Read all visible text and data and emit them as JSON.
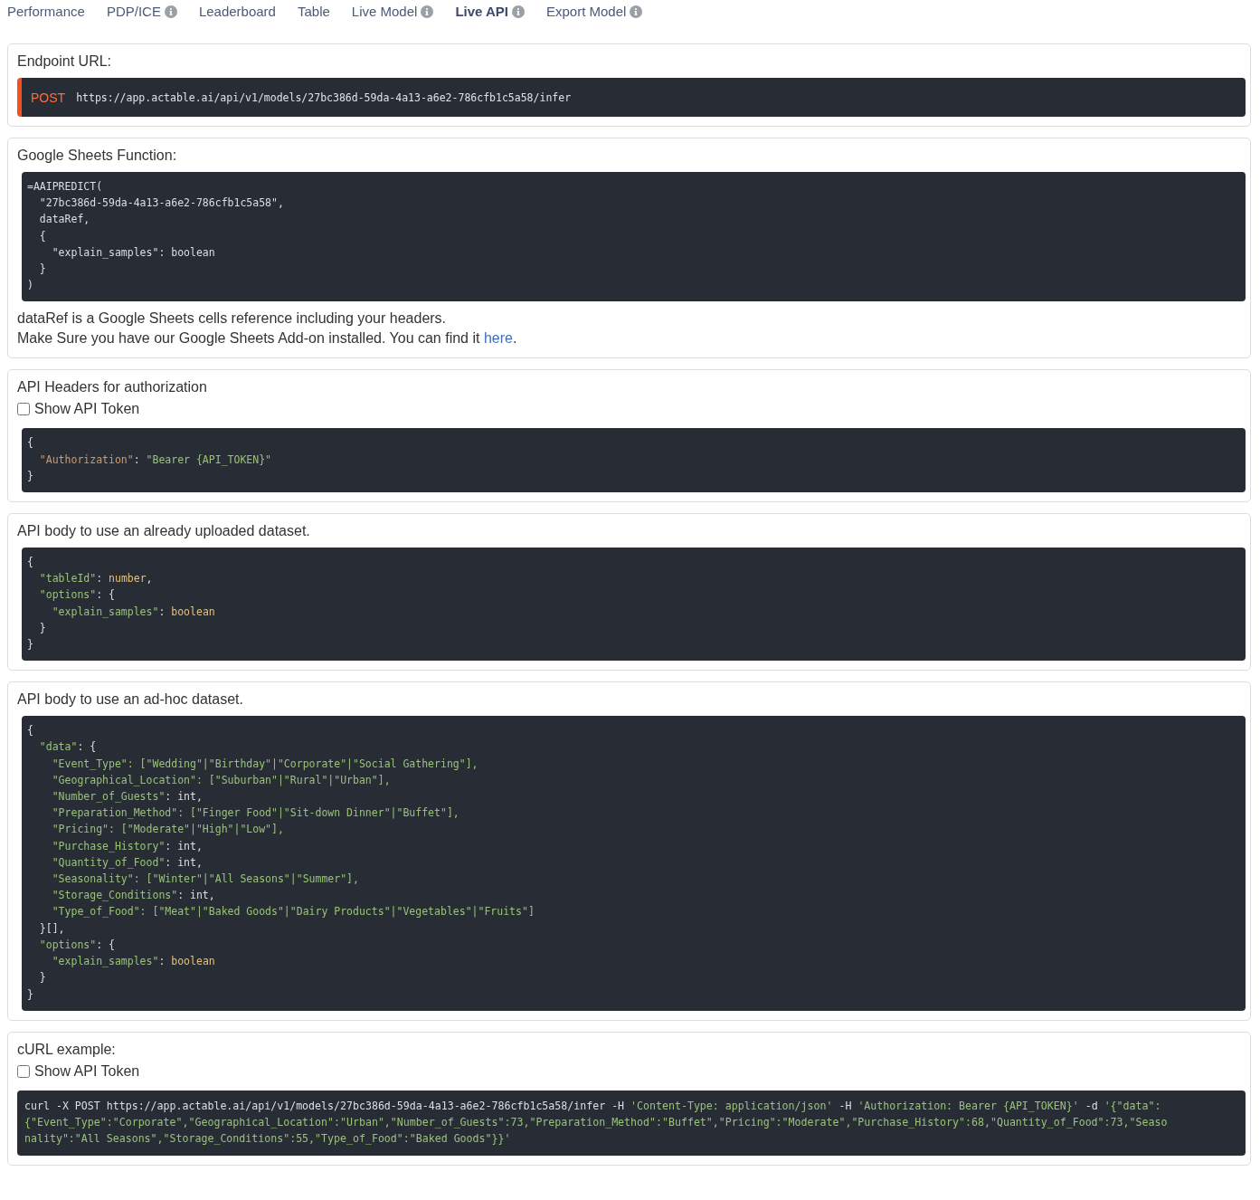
{
  "tabs": [
    {
      "label": "Performance",
      "selected": false,
      "info": false
    },
    {
      "label": "PDP/ICE",
      "selected": false,
      "info": true
    },
    {
      "label": "Leaderboard",
      "selected": false,
      "info": false
    },
    {
      "label": "Table",
      "selected": false,
      "info": false
    },
    {
      "label": "Live Model",
      "selected": false,
      "info": true
    },
    {
      "label": "Live API",
      "selected": true,
      "info": true
    },
    {
      "label": "Export Model",
      "selected": false,
      "info": true
    }
  ],
  "sections": [
    {
      "title": "Endpoint URL:",
      "endpoint": {
        "method": "POST",
        "url": "https://app.actable.ai/api/v1/models/27bc386d-59da-4a13-a6e2-786cfb1c5a58/infer"
      }
    },
    {
      "title": "Google Sheets Function:",
      "code": [
        [
          {
            "kind": "plain",
            "text": "=AAIPREDICT("
          }
        ],
        [
          {
            "kind": "plain",
            "text": "  \"27bc386d-59da-4a13-a6e2-786cfb1c5a58\","
          }
        ],
        [
          {
            "kind": "plain",
            "text": "  dataRef,"
          }
        ],
        [
          {
            "kind": "plain",
            "text": "  {"
          }
        ],
        [
          {
            "kind": "plain",
            "text": "    \"explain_samples\": boolean"
          }
        ],
        [
          {
            "kind": "plain",
            "text": "  }"
          }
        ],
        [
          {
            "kind": "plain",
            "text": ")"
          }
        ]
      ],
      "notes": [
        {
          "text": "dataRef is a Google Sheets cells reference including your headers."
        },
        {
          "text": "Make Sure you have our Google Sheets Add-on installed. You can find it ",
          "link": "here",
          "after": "."
        }
      ]
    },
    {
      "title": "API Headers for authorization",
      "checkbox": {
        "label": "Show API Token",
        "checked": false
      },
      "code": [
        [
          {
            "kind": "plain",
            "text": "{"
          }
        ],
        [
          {
            "kind": "attr",
            "text": "  \"Authorization\""
          },
          {
            "kind": "plain",
            "text": ": "
          },
          {
            "kind": "string",
            "text": "\"Bearer {API_TOKEN}\""
          }
        ],
        [
          {
            "kind": "plain",
            "text": "}"
          }
        ]
      ]
    },
    {
      "title": "API body to use an already uploaded dataset.",
      "code": [
        [
          {
            "kind": "plain",
            "text": "{"
          }
        ],
        [
          {
            "kind": "string",
            "text": "  \"tableId\""
          },
          {
            "kind": "plain",
            "text": ": "
          },
          {
            "kind": "keyword",
            "text": "number"
          },
          {
            "kind": "plain",
            "text": ","
          }
        ],
        [
          {
            "kind": "string",
            "text": "  \"options\""
          },
          {
            "kind": "plain",
            "text": ": {"
          }
        ],
        [
          {
            "kind": "string",
            "text": "    \"explain_samples\""
          },
          {
            "kind": "plain",
            "text": ": "
          },
          {
            "kind": "keyword",
            "text": "boolean"
          }
        ],
        [
          {
            "kind": "plain",
            "text": "  }"
          }
        ],
        [
          {
            "kind": "plain",
            "text": "}"
          }
        ]
      ]
    },
    {
      "title": "API body to use an ad-hoc dataset.",
      "code": [
        [
          {
            "kind": "plain",
            "text": "{"
          }
        ],
        [
          {
            "kind": "string",
            "text": "  \"data\""
          },
          {
            "kind": "plain",
            "text": ": {"
          }
        ],
        [
          {
            "kind": "string",
            "text": "    \"Event_Type\": [\"Wedding\"|\"Birthday\"|\"Corporate\"|\"Social Gathering\"],"
          }
        ],
        [
          {
            "kind": "string",
            "text": "    \"Geographical_Location\": [\"Suburban\"|\"Rural\"|\"Urban\"],"
          }
        ],
        [
          {
            "kind": "string",
            "text": "    \"Number_of_Guests\""
          },
          {
            "kind": "plain",
            "text": ": int,"
          }
        ],
        [
          {
            "kind": "string",
            "text": "    \"Preparation_Method\": [\"Finger Food\"|\"Sit-down Dinner\"|\"Buffet\"],"
          }
        ],
        [
          {
            "kind": "string",
            "text": "    \"Pricing\": [\"Moderate\"|\"High\"|\"Low\"],"
          }
        ],
        [
          {
            "kind": "string",
            "text": "    \"Purchase_History\""
          },
          {
            "kind": "plain",
            "text": ": int,"
          }
        ],
        [
          {
            "kind": "string",
            "text": "    \"Quantity_of_Food\""
          },
          {
            "kind": "plain",
            "text": ": int,"
          }
        ],
        [
          {
            "kind": "string",
            "text": "    \"Seasonality\": [\"Winter\"|\"All Seasons\"|\"Summer\"],"
          }
        ],
        [
          {
            "kind": "string",
            "text": "    \"Storage_Conditions\""
          },
          {
            "kind": "plain",
            "text": ": int,"
          }
        ],
        [
          {
            "kind": "string",
            "text": "    \"Type_of_Food\": [\"Meat\"|\"Baked Goods\"|\"Dairy Products\"|\"Vegetables\"|\"Fruits\"]"
          }
        ],
        [
          {
            "kind": "plain",
            "text": "  }[],"
          }
        ],
        [
          {
            "kind": "string",
            "text": "  \"options\""
          },
          {
            "kind": "plain",
            "text": ": {"
          }
        ],
        [
          {
            "kind": "string",
            "text": "    \"explain_samples\""
          },
          {
            "kind": "plain",
            "text": ": "
          },
          {
            "kind": "keyword",
            "text": "boolean"
          }
        ],
        [
          {
            "kind": "plain",
            "text": "  }"
          }
        ],
        [
          {
            "kind": "plain",
            "text": "}"
          }
        ]
      ]
    },
    {
      "title": "cURL example:",
      "checkbox": {
        "label": "Show API Token",
        "checked": false
      },
      "compact": true,
      "code": [
        [
          {
            "kind": "plain",
            "text": "curl -X POST https://app.actable.ai/api/v1/models/27bc386d-59da-4a13-a6e2-786cfb1c5a58/infer -H "
          },
          {
            "kind": "string",
            "text": "'Content-Type: application/json'"
          },
          {
            "kind": "plain",
            "text": " -H "
          },
          {
            "kind": "string",
            "text": "'Authorization: Bearer {API_TOKEN}'"
          },
          {
            "kind": "plain",
            "text": " -d "
          },
          {
            "kind": "string",
            "text": "'{\"data\":"
          }
        ],
        [
          {
            "kind": "string",
            "text": "{\"Event_Type\":\"Corporate\",\"Geographical_Location\":\"Urban\",\"Number_of_Guests\":73,\"Preparation_Method\":\"Buffet\",\"Pricing\":\"Moderate\",\"Purchase_History\":68,\"Quantity_of_Food\":73,\"Seaso"
          }
        ],
        [
          {
            "kind": "string",
            "text": "nality\":\"All Seasons\",\"Storage_Conditions\":55,\"Type_of_Food\":\"Baked Goods\"}}'"
          }
        ]
      ]
    }
  ]
}
